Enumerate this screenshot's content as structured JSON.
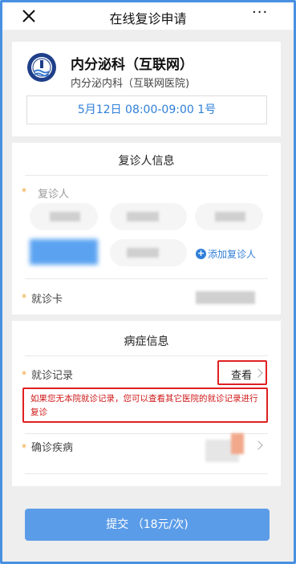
{
  "navbar": {
    "title": "在线复诊申请",
    "close_icon": "close-icon",
    "more_icon": "more-icon",
    "more_text": "···"
  },
  "hospital": {
    "name": "内分泌科（互联网）",
    "department": "内分泌内科（互联网医院)",
    "slot": "5月12日 08:00-09:00 1号",
    "logo_icon": "hospital-logo-icon"
  },
  "patient_section": {
    "title": "复诊人信息",
    "patient_label": "复诊人",
    "add_patient_label": "添加复诊人",
    "card_label": "就诊卡"
  },
  "illness_section": {
    "title": "病症信息",
    "record_label": "就诊记录",
    "view_label": "查看",
    "notice": "如果您无本院就诊记录，您可以查看其它医院的就诊记录进行复诊",
    "diagnosis_label": "确诊疾病"
  },
  "submit": {
    "label": "提交 （18元/次)"
  },
  "colors": {
    "accent_blue": "#2f7fd8",
    "button_blue": "#5b9ce8",
    "highlight_red": "#e02020",
    "required_star": "#f0a030"
  }
}
